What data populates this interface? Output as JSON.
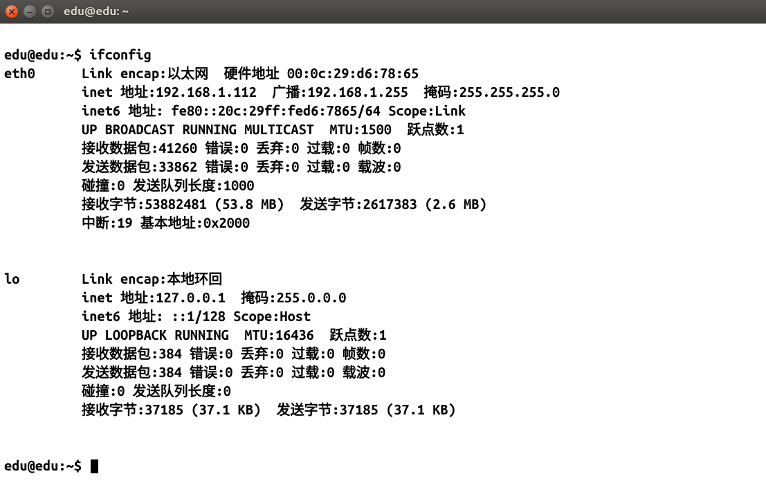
{
  "window": {
    "title": "edu@edu: ~"
  },
  "prompt1": "edu@edu:~$ ",
  "command": "ifconfig",
  "eth0": {
    "name": "eth0",
    "line1": "Link encap:以太网  硬件地址 00:0c:29:d6:78:65",
    "line2": "inet 地址:192.168.1.112  广播:192.168.1.255  掩码:255.255.255.0",
    "line3": "inet6 地址: fe80::20c:29ff:fed6:7865/64 Scope:Link",
    "line4": "UP BROADCAST RUNNING MULTICAST  MTU:1500  跃点数:1",
    "line5": "接收数据包:41260 错误:0 丢弃:0 过载:0 帧数:0",
    "line6": "发送数据包:33862 错误:0 丢弃:0 过载:0 载波:0",
    "line7": "碰撞:0 发送队列长度:1000",
    "line8": "接收字节:53882481 (53.8 MB)  发送字节:2617383 (2.6 MB)",
    "line9": "中断:19 基本地址:0x2000"
  },
  "lo": {
    "name": "lo",
    "line1": "Link encap:本地环回",
    "line2": "inet 地址:127.0.0.1  掩码:255.0.0.0",
    "line3": "inet6 地址: ::1/128 Scope:Host",
    "line4": "UP LOOPBACK RUNNING  MTU:16436  跃点数:1",
    "line5": "接收数据包:384 错误:0 丢弃:0 过载:0 帧数:0",
    "line6": "发送数据包:384 错误:0 丢弃:0 过载:0 载波:0",
    "line7": "碰撞:0 发送队列长度:0",
    "line8": "接收字节:37185 (37.1 KB)  发送字节:37185 (37.1 KB)"
  },
  "prompt2": "edu@edu:~$ "
}
